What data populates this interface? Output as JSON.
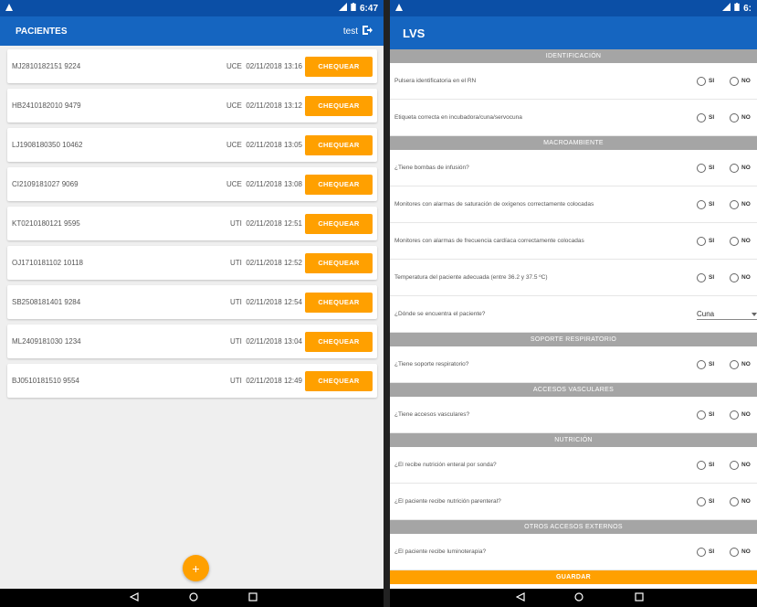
{
  "left": {
    "status": {
      "time": "6:47"
    },
    "header": {
      "title": "PACIENTES",
      "user": "test"
    },
    "patients": [
      {
        "code": "MJ2810182151 9224",
        "unit": "UCE",
        "datetime": "02/11/2018 13:16",
        "action": "CHEQUEAR"
      },
      {
        "code": "HB2410182010 9479",
        "unit": "UCE",
        "datetime": "02/11/2018 13:12",
        "action": "CHEQUEAR"
      },
      {
        "code": "LJ1908180350 10462",
        "unit": "UCE",
        "datetime": "02/11/2018 13:05",
        "action": "CHEQUEAR"
      },
      {
        "code": "CI2109181027 9069",
        "unit": "UCE",
        "datetime": "02/11/2018 13:08",
        "action": "CHEQUEAR"
      },
      {
        "code": "KT0210180121 9595",
        "unit": "UTI",
        "datetime": "02/11/2018 12:51",
        "action": "CHEQUEAR"
      },
      {
        "code": "OJ1710181102 10118",
        "unit": "UTI",
        "datetime": "02/11/2018 12:52",
        "action": "CHEQUEAR"
      },
      {
        "code": "SB2508181401 9284",
        "unit": "UTI",
        "datetime": "02/11/2018 12:54",
        "action": "CHEQUEAR"
      },
      {
        "code": "ML2409181030 1234",
        "unit": "UTI",
        "datetime": "02/11/2018 13:04",
        "action": "CHEQUEAR"
      },
      {
        "code": "BJ0510181510 9554",
        "unit": "UTI",
        "datetime": "02/11/2018 12:49",
        "action": "CHEQUEAR"
      }
    ],
    "fab_label": "+"
  },
  "right": {
    "status": {
      "time": "6:"
    },
    "header": {
      "title": "LVS"
    },
    "radio_labels": {
      "yes": "SI",
      "no": "NO"
    },
    "items": [
      {
        "kind": "section",
        "label": "IDENTIFICACIÓN"
      },
      {
        "kind": "question",
        "label": "Pulsera identificatoria en el RN"
      },
      {
        "kind": "question",
        "label": "Etiqueta correcta en incubadora/cuna/servocuna"
      },
      {
        "kind": "section",
        "label": "MACROAMBIENTE"
      },
      {
        "kind": "question",
        "label": "¿Tiene bombas de infusión?"
      },
      {
        "kind": "question",
        "label": "Monitores con alarmas de saturación de oxígenos correctamente colocadas"
      },
      {
        "kind": "question",
        "label": "Monitores con alarmas de frecuencia cardíaca correctamente colocadas"
      },
      {
        "kind": "question",
        "label": "Temperatura del paciente adecuada (entre 36.2 y 37.5 ºC)"
      },
      {
        "kind": "select",
        "label": "¿Dónde se encuentra el paciente?",
        "value": "Cuna"
      },
      {
        "kind": "section",
        "label": "SOPORTE RESPIRATORIO"
      },
      {
        "kind": "question",
        "label": "¿Tiene soporte respiratorio?"
      },
      {
        "kind": "section",
        "label": "ACCESOS VASCULARES"
      },
      {
        "kind": "question",
        "label": "¿Tiene accesos vasculares?"
      },
      {
        "kind": "section",
        "label": "NUTRICIÓN"
      },
      {
        "kind": "question",
        "label": "¿El recibe nutrición enteral por sonda?"
      },
      {
        "kind": "question",
        "label": "¿El paciente recibe nutrición parenteral?"
      },
      {
        "kind": "section",
        "label": "OTROS ACCESOS EXTERNOS"
      },
      {
        "kind": "question",
        "label": "¿El paciente recibe luminoterapia?"
      }
    ],
    "save_label": "GUARDAR"
  },
  "colors": {
    "primary": "#1565c0",
    "statusbar": "#0b4fa6",
    "accent": "#ffa000",
    "section": "#a5a5a5"
  }
}
